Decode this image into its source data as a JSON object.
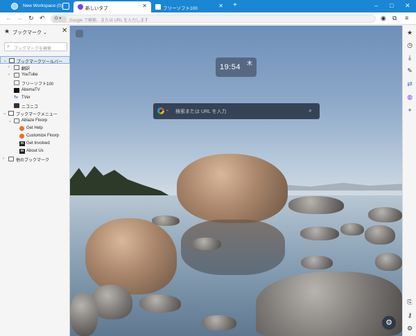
{
  "window": {
    "workspace": "New Workspace (0)",
    "tabs": [
      {
        "title": "新しいタブ",
        "active": true
      },
      {
        "title": "フリーソフト100",
        "active": false
      }
    ],
    "new_tab": "+",
    "controls": {
      "minimize": "–",
      "maximize": "□",
      "close": "✕"
    }
  },
  "nav": {
    "back": "←",
    "forward": "→",
    "reload": "↻",
    "undo": "↶",
    "engine": "G ▾",
    "url_placeholder": "Google で検索、または URL を入力します"
  },
  "sidebar": {
    "title": "ブックマーク",
    "close": "✕",
    "search_placeholder": "ブックマークを検索",
    "tree": [
      {
        "label": "ブックマークツールバー",
        "depth": 0,
        "twisty": "⌄",
        "icon": "bar",
        "selected": true
      },
      {
        "label": "翻訳",
        "depth": 1,
        "twisty": "›",
        "icon": "folder"
      },
      {
        "label": "YouTube",
        "depth": 1,
        "twisty": "›",
        "icon": "folder"
      },
      {
        "label": "フリーソフト100",
        "depth": 1,
        "twisty": "",
        "icon": "page"
      },
      {
        "label": "AbemaTV",
        "depth": 1,
        "twisty": "",
        "icon": "abema"
      },
      {
        "label": "TVer",
        "depth": 1,
        "twisty": "",
        "icon": "tver"
      },
      {
        "label": "ニコニコ",
        "depth": 1,
        "twisty": "",
        "icon": "nico"
      },
      {
        "label": "ブックマークメニュー",
        "depth": 0,
        "twisty": "⌄",
        "icon": "bar"
      },
      {
        "label": "Ablaze Floorp",
        "depth": 1,
        "twisty": "⌄",
        "icon": "folder"
      },
      {
        "label": "Get Help",
        "depth": 2,
        "twisty": "",
        "icon": "floorp"
      },
      {
        "label": "Customize Floorp",
        "depth": 2,
        "twisty": "",
        "icon": "floorp"
      },
      {
        "label": "Get Involved",
        "depth": 2,
        "twisty": "",
        "icon": "m"
      },
      {
        "label": "About Us",
        "depth": 2,
        "twisty": "",
        "icon": "m"
      },
      {
        "label": "他のブックマーク",
        "depth": 0,
        "twisty": "›",
        "icon": "folder"
      }
    ]
  },
  "newtab": {
    "clock_time": "19:54",
    "clock_day": "木",
    "search_placeholder": "検索または URL を入力"
  },
  "rail_icons": [
    "star-icon",
    "history-icon",
    "download-icon",
    "pen-icon",
    "translate-icon",
    "floorp-icon",
    "add-icon"
  ]
}
